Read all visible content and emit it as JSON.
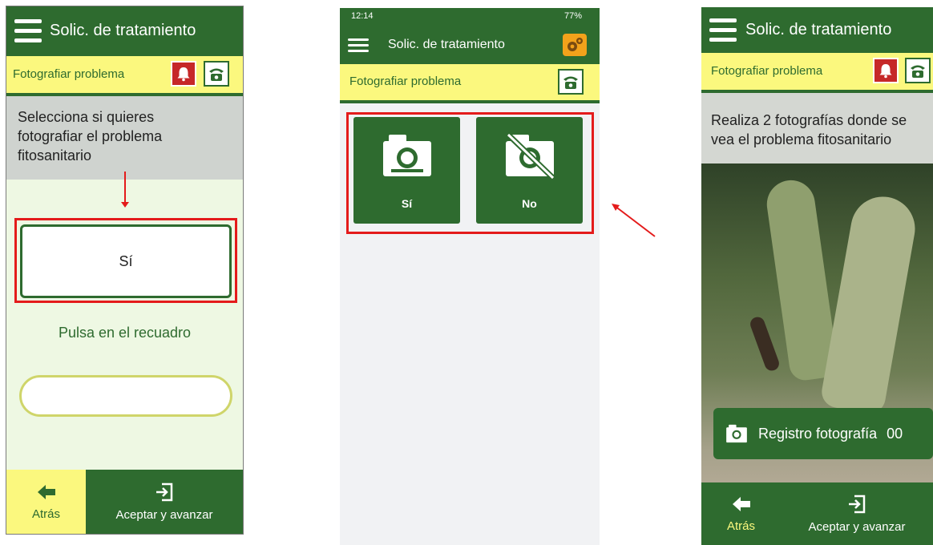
{
  "screen1": {
    "app_title": "Solic. de tratamiento",
    "subtitle": "Fotografiar problema",
    "instruction": "Selecciona si quieres fotografiar el problema fitosanitario",
    "option_label": "Sí",
    "hint": "Pulsa en el recuadro",
    "input_value": "",
    "back_label": "Atrás",
    "accept_label": "Aceptar y avanzar"
  },
  "screen2": {
    "status_time": "12:14",
    "status_battery": "77%",
    "app_title": "Solic. de tratamiento",
    "subtitle": "Fotografiar problema",
    "option_yes": "Sí",
    "option_no": "No"
  },
  "screen3": {
    "app_title": "Solic. de tratamiento",
    "subtitle": "Fotografiar problema",
    "instruction": "Realiza 2 fotografías donde se vea el problema fitosanitario",
    "photo_register_label": "Registro fotografía",
    "photo_count": "00",
    "back_label": "Atrás",
    "accept_label": "Aceptar y avanzar"
  },
  "colors": {
    "primary_green": "#2e6b2f",
    "accent_yellow": "#fbf87e",
    "highlight_red": "#e41b1b",
    "alert_red": "#c62828",
    "settings_orange": "#f2a21b"
  },
  "icons": [
    "hamburger-icon",
    "bell-icon",
    "phone-icon",
    "settings-gears-icon",
    "camera-icon",
    "camera-off-icon",
    "arrow-left-icon",
    "enter-icon"
  ]
}
